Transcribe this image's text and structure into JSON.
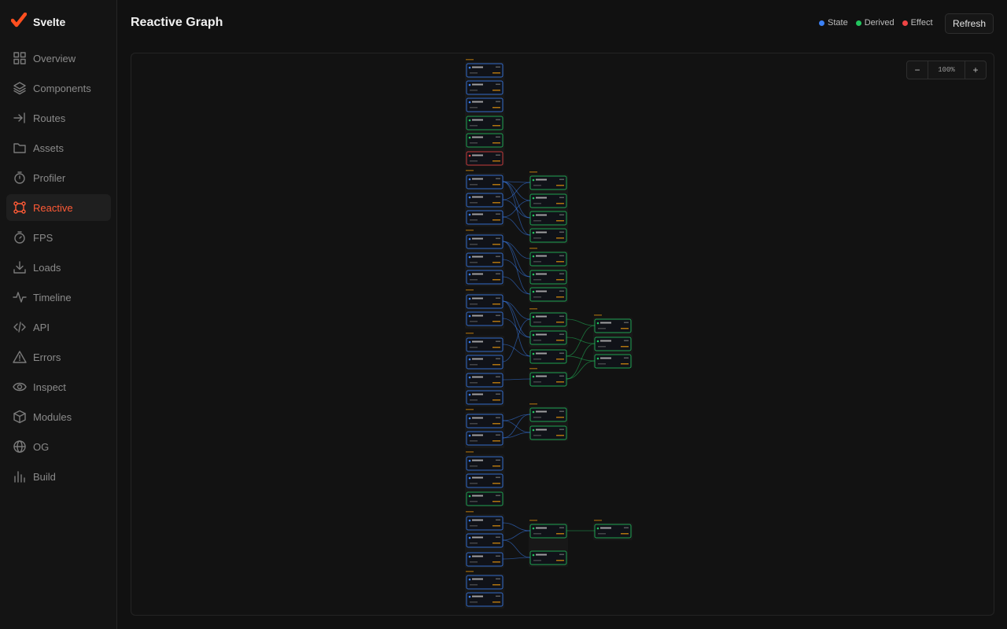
{
  "app": {
    "name": "Svelte"
  },
  "sidebar": {
    "items": [
      {
        "label": "Overview",
        "icon": "grid-icon"
      },
      {
        "label": "Components",
        "icon": "layers-icon"
      },
      {
        "label": "Routes",
        "icon": "route-icon"
      },
      {
        "label": "Assets",
        "icon": "folder-icon"
      },
      {
        "label": "Profiler",
        "icon": "timer-icon"
      },
      {
        "label": "Reactive",
        "icon": "graph-icon",
        "active": true
      },
      {
        "label": "FPS",
        "icon": "stopwatch-icon"
      },
      {
        "label": "Loads",
        "icon": "download-icon"
      },
      {
        "label": "Timeline",
        "icon": "activity-icon"
      },
      {
        "label": "API",
        "icon": "code-icon"
      },
      {
        "label": "Errors",
        "icon": "warning-icon"
      },
      {
        "label": "Inspect",
        "icon": "eye-icon"
      },
      {
        "label": "Modules",
        "icon": "box-icon"
      },
      {
        "label": "OG",
        "icon": "globe-icon"
      },
      {
        "label": "Build",
        "icon": "bar-chart-icon"
      }
    ]
  },
  "header": {
    "title": "Reactive Graph",
    "refresh_label": "Refresh"
  },
  "legend": [
    {
      "label": "State",
      "color": "#3b82f6"
    },
    {
      "label": "Derived",
      "color": "#22c55e"
    },
    {
      "label": "Effect",
      "color": "#ef4444"
    }
  ],
  "zoom": {
    "level": "100%",
    "minus": "−",
    "plus": "+"
  },
  "colors": {
    "accent": "#ff5a36",
    "state": "#3b82f6",
    "derived": "#22c55e",
    "effect": "#ef4444"
  }
}
